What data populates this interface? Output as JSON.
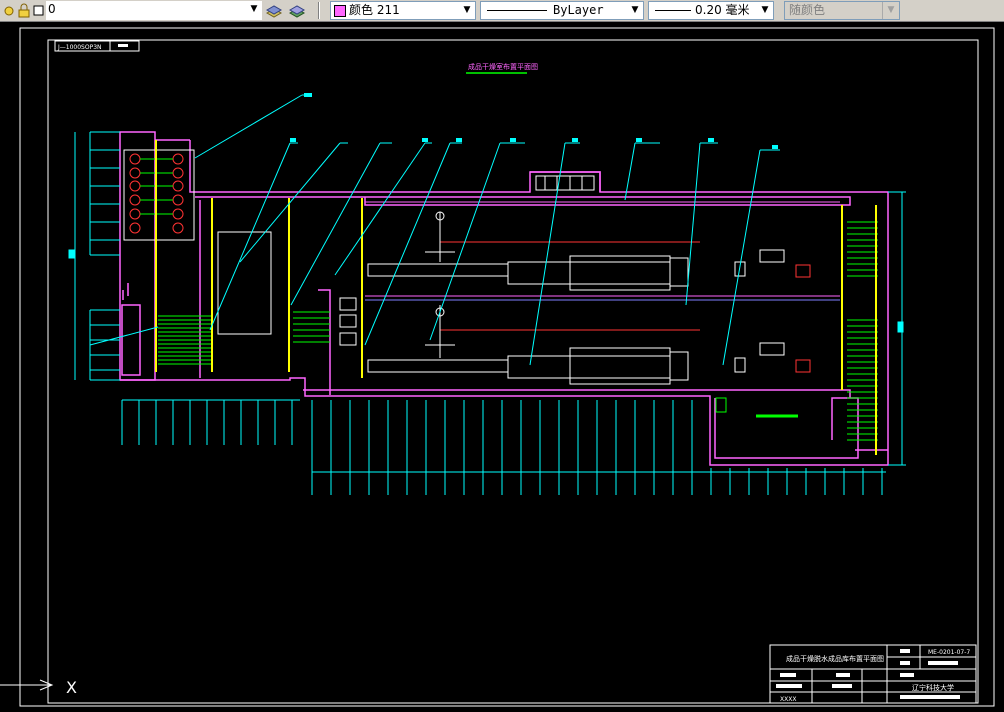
{
  "toolbar": {
    "layer_name": "0",
    "color_label": "颜色 211",
    "color_swatch": "#ff66ff",
    "linetype_label": "ByLayer",
    "lineweight_label": "0.20 毫米",
    "plotstyle_label": "随颜色",
    "icons": [
      "layer-state-icon",
      "layer-properties-icon",
      "layer-previous-icon"
    ]
  },
  "drawing": {
    "title": "成品干燥室布置平面图",
    "frame_tag": "J—1000SOP3N",
    "title_block": {
      "drawing_name": "成品干燥脱水成品库布置平面图",
      "drawing_number": "ME-0201-07-7",
      "school": "辽宁科技大学",
      "scale_label": "XXXX"
    },
    "colors": {
      "background": "#000000",
      "wall": "#ff66ff",
      "dimension": "#00ffff",
      "column": "#ffff00",
      "equipment": "#ffffff",
      "frame": "#ffffff",
      "pipe": "#00ff00",
      "red_line": "#ff3333"
    }
  },
  "ucs": {
    "x_label": "X"
  }
}
